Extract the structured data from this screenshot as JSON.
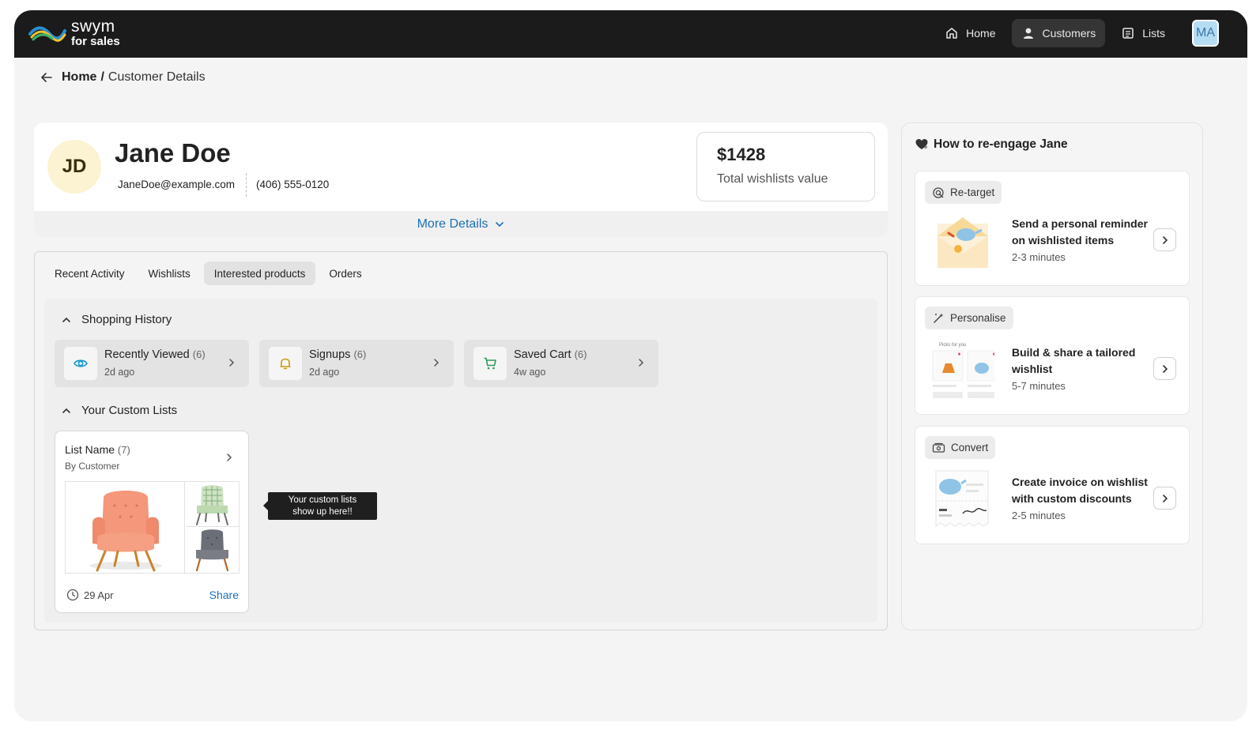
{
  "brand": {
    "line1": "swym",
    "line2": "for sales"
  },
  "nav": {
    "home": "Home",
    "customers": "Customers",
    "lists": "Lists",
    "avatar": "MA"
  },
  "breadcrumb": {
    "home": "Home",
    "separator": "/",
    "current": "Customer Details"
  },
  "customer": {
    "initials": "JD",
    "name": "Jane Doe",
    "email": "JaneDoe@example.com",
    "phone": "(406) 555-0120",
    "wishlist_value": "$1428",
    "wishlist_value_label": "Total wishlists value",
    "more_details": "More Details"
  },
  "tabs": [
    "Recent Activity",
    "Wishlists",
    "Interested products",
    "Orders"
  ],
  "active_tab": "Interested products",
  "shopping_history": {
    "title": "Shopping History",
    "items": [
      {
        "label": "Recently Viewed",
        "count": "(6)",
        "time": "2d ago",
        "icon": "eye-icon"
      },
      {
        "label": "Signups",
        "count": "(6)",
        "time": "2d ago",
        "icon": "bell-icon"
      },
      {
        "label": "Saved Cart",
        "count": "(6)",
        "time": "4w ago",
        "icon": "cart-icon"
      }
    ]
  },
  "custom_lists": {
    "title": "Your Custom Lists",
    "list": {
      "name": "List Name",
      "count": "(7)",
      "by": "By Customer",
      "date": "29 Apr",
      "share": "Share"
    },
    "tooltip_line1": "Your custom lists",
    "tooltip_line2": "show up here!!"
  },
  "reengage": {
    "title": "How to re-engage Jane",
    "cards": [
      {
        "tag": "Re-target",
        "title": "Send a personal reminder on wishlisted items",
        "duration": "2-3 minutes"
      },
      {
        "tag": "Personalise",
        "title": "Build & share a tailored wishlist",
        "duration": "5-7 minutes",
        "illustration_caption": "Picks for you"
      },
      {
        "tag": "Convert",
        "title": "Create invoice on wishlist with custom discounts",
        "duration": "2-5 minutes"
      }
    ]
  },
  "colors": {
    "topbar": "#1b1b1b",
    "accent": "#1d6fb8",
    "avatar_bg": "#fbf3d1",
    "eye_icon": "#1a9ad0",
    "bell_icon": "#c89a10",
    "cart_icon": "#2e9a5a"
  }
}
